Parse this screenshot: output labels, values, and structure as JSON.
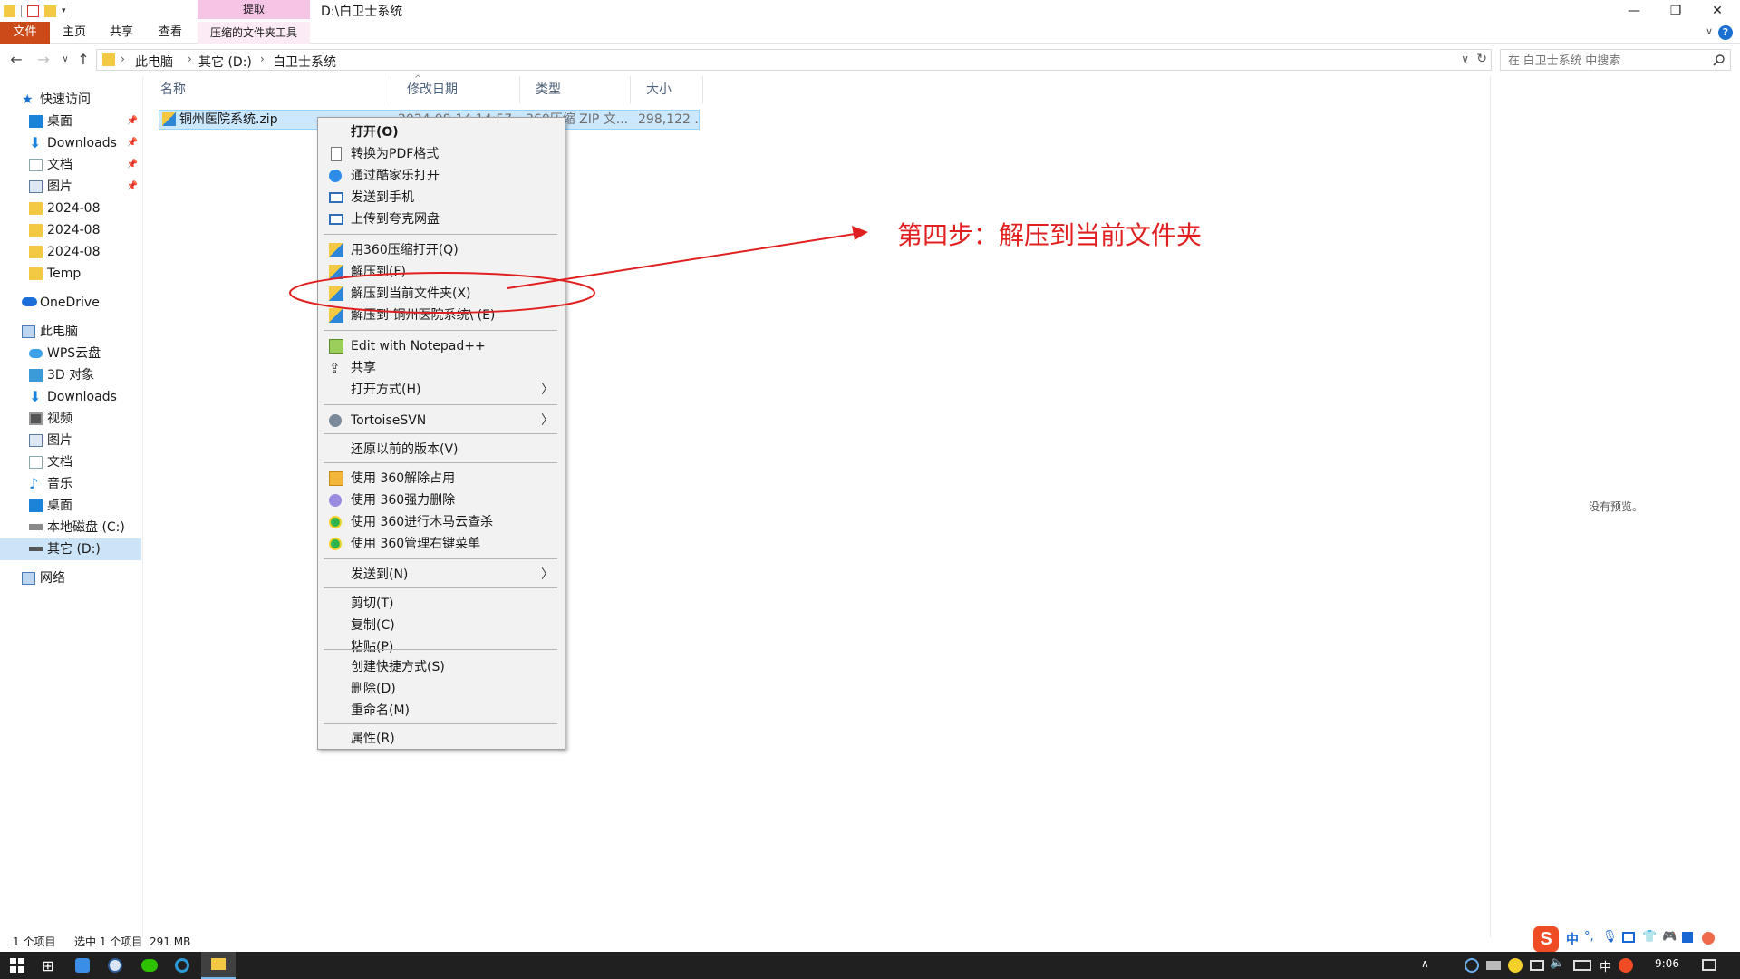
{
  "window": {
    "title": "D:\\白卫士系统",
    "context_tab_top": "提取",
    "context_tab_bottom": "压缩的文件夹工具"
  },
  "ribbon": {
    "tabs": [
      "文件",
      "主页",
      "共享",
      "查看"
    ]
  },
  "address": {
    "crumbs": [
      "此电脑",
      "其它 (D:)",
      "白卫士系统"
    ]
  },
  "search": {
    "placeholder": "在 白卫士系统 中搜索"
  },
  "nav": {
    "quick_access": "快速访问",
    "quick_items": [
      {
        "label": "桌面",
        "pinned": true
      },
      {
        "label": "Downloads",
        "pinned": true
      },
      {
        "label": "文档",
        "pinned": true
      },
      {
        "label": "图片",
        "pinned": true
      },
      {
        "label": "2024-08",
        "pinned": false
      },
      {
        "label": "2024-08",
        "pinned": false
      },
      {
        "label": "2024-08",
        "pinned": false
      },
      {
        "label": "Temp",
        "pinned": false
      }
    ],
    "onedrive": "OneDrive",
    "this_pc": "此电脑",
    "pc_items": [
      "WPS云盘",
      "3D 对象",
      "Downloads",
      "视频",
      "图片",
      "文档",
      "音乐",
      "桌面",
      "本地磁盘 (C:)",
      "其它 (D:)"
    ],
    "network": "网络",
    "selected": "其它 (D:)"
  },
  "columns": [
    "名称",
    "修改日期",
    "类型",
    "大小"
  ],
  "files": [
    {
      "name": "铜州医院系统.zip",
      "date": "2024-08-14 14:57",
      "type": "360压缩 ZIP 文...",
      "size": "298,122 ..."
    }
  ],
  "context_menu": {
    "groups": [
      [
        {
          "label": "打开(O)",
          "icon": "none",
          "bold": true
        },
        {
          "label": "转换为PDF格式",
          "icon": "pdf-page-icon"
        },
        {
          "label": "通过酷家乐打开",
          "icon": "kujiale-icon"
        },
        {
          "label": "发送到手机",
          "icon": "phone-send-icon"
        },
        {
          "label": "上传到夸克网盘",
          "icon": "quark-upload-icon"
        }
      ],
      [
        {
          "label": "用360压缩打开(Q)",
          "icon": "360zip-icon"
        },
        {
          "label": "解压到(F)",
          "icon": "360zip-icon"
        },
        {
          "label": "解压到当前文件夹(X)",
          "icon": "360zip-icon"
        },
        {
          "label": "解压到 铜州医院系统\\ (E)",
          "icon": "360zip-icon"
        }
      ],
      [
        {
          "label": "Edit with Notepad++",
          "icon": "notepadpp-icon"
        },
        {
          "label": "共享",
          "icon": "share-icon"
        },
        {
          "label": "打开方式(H)",
          "icon": "none",
          "submenu": true
        }
      ],
      [
        {
          "label": "TortoiseSVN",
          "icon": "tortoisesvn-icon",
          "submenu": true
        }
      ],
      [
        {
          "label": "还原以前的版本(V)",
          "icon": "none"
        }
      ],
      [
        {
          "label": "使用 360解除占用",
          "icon": "360-unlock-icon"
        },
        {
          "label": "使用 360强力删除",
          "icon": "360-delete-icon"
        },
        {
          "label": "使用 360进行木马云查杀",
          "icon": "360-scan-icon"
        },
        {
          "label": "使用 360管理右键菜单",
          "icon": "360-menu-icon"
        }
      ],
      [
        {
          "label": "发送到(N)",
          "icon": "none",
          "submenu": true
        }
      ],
      [
        {
          "label": "剪切(T)",
          "icon": "none"
        },
        {
          "label": "复制(C)",
          "icon": "none"
        },
        {
          "label": "粘贴(P)",
          "icon": "none"
        }
      ],
      [
        {
          "label": "创建快捷方式(S)",
          "icon": "none"
        },
        {
          "label": "删除(D)",
          "icon": "none"
        },
        {
          "label": "重命名(M)",
          "icon": "none"
        }
      ],
      [
        {
          "label": "属性(R)",
          "icon": "none"
        }
      ]
    ]
  },
  "annotation": {
    "text": "第四步：解压到当前文件夹",
    "color": "#e02020"
  },
  "preview": {
    "text": "没有预览。"
  },
  "status": {
    "count": "1 个项目",
    "selected": "选中 1 个项目",
    "size": "291 MB"
  },
  "ime": {
    "mode": "中"
  },
  "taskbar": {
    "lang": "中",
    "time": "9:06"
  },
  "colors": {
    "accent": "#cc4a1a",
    "selection": "#cce8ff",
    "context_tab": "#f6c4e4",
    "taskbar": "#202020"
  }
}
